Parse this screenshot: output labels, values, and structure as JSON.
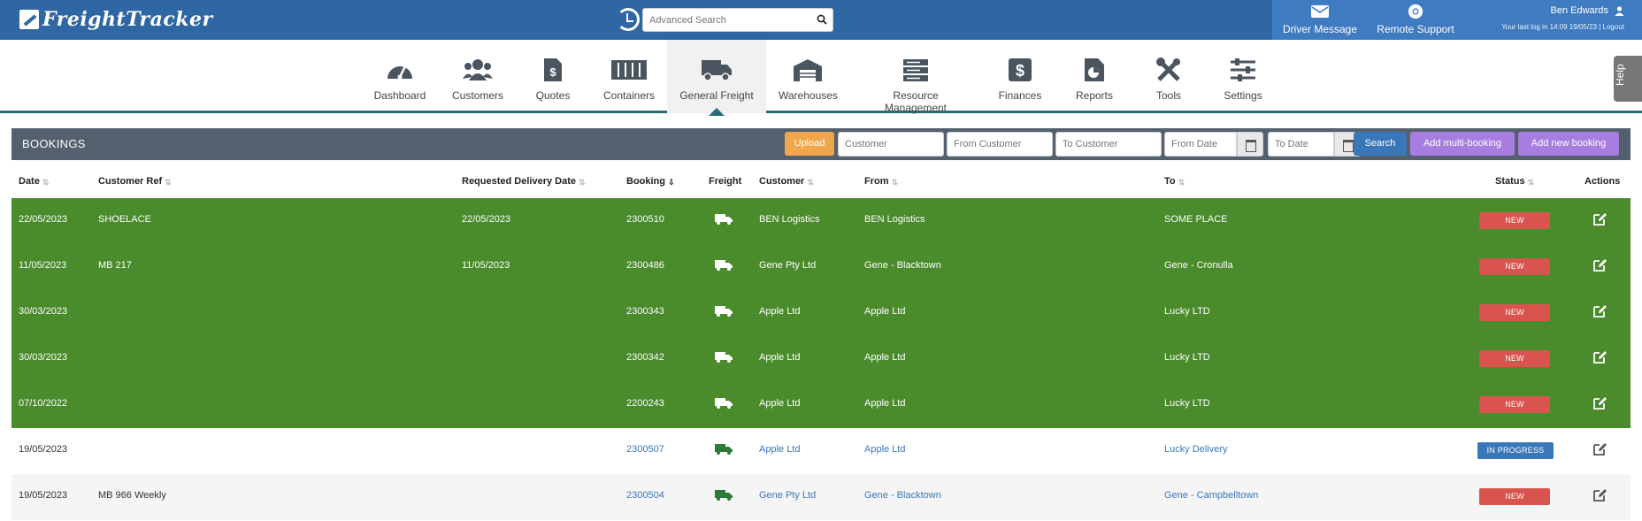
{
  "app": {
    "name": "FreightTracker"
  },
  "top": {
    "search_placeholder": "Advanced Search",
    "driver_message": "Driver Message",
    "remote_support": "Remote Support",
    "user_name": "Ben Edwards",
    "last_login": "Your last log in 14:09 19/05/23",
    "logout": "Logout"
  },
  "nav": {
    "items": [
      {
        "label": "Dashboard",
        "icon": "dashboard-icon"
      },
      {
        "label": "Customers",
        "icon": "users-icon"
      },
      {
        "label": "Quotes",
        "icon": "quote-icon"
      },
      {
        "label": "Containers",
        "icon": "container-icon"
      },
      {
        "label": "General Freight",
        "icon": "truck-icon",
        "active": true
      },
      {
        "label": "Warehouses",
        "icon": "warehouse-icon"
      },
      {
        "label": "Resource Management",
        "icon": "server-icon"
      },
      {
        "label": "Finances",
        "icon": "dollar-icon"
      },
      {
        "label": "Reports",
        "icon": "report-icon"
      },
      {
        "label": "Tools",
        "icon": "tools-icon"
      },
      {
        "label": "Settings",
        "icon": "sliders-icon"
      }
    ],
    "help": "Help"
  },
  "panel": {
    "title": "BOOKINGS",
    "upload": "Upload",
    "customer_placeholder": "Customer",
    "from_customer_placeholder": "From Customer",
    "to_customer_placeholder": "To Customer",
    "from_date_placeholder": "From Date",
    "to_date_placeholder": "To Date",
    "search": "Search",
    "add_multi": "Add multi-booking",
    "add_new": "Add new booking"
  },
  "columns": {
    "date": "Date",
    "customer_ref": "Customer Ref",
    "requested_delivery": "Requested Delivery Date",
    "booking": "Booking",
    "freight": "Freight",
    "customer": "Customer",
    "from": "From",
    "to": "To",
    "status": "Status",
    "actions": "Actions"
  },
  "rows": [
    {
      "date": "22/05/2023",
      "ref": "SHOELACE",
      "req": "22/05/2023",
      "booking": "2300510",
      "customer": "BEN Logistics",
      "from": "BEN Logistics",
      "to": "SOME PLACE",
      "status": "NEW",
      "style": "green"
    },
    {
      "date": "11/05/2023",
      "ref": "MB 217",
      "req": "11/05/2023",
      "booking": "2300486",
      "customer": "Gene Pty Ltd",
      "from": "Gene - Blacktown",
      "to": "Gene - Cronulla",
      "status": "NEW",
      "style": "green"
    },
    {
      "date": "30/03/2023",
      "ref": "",
      "req": "",
      "booking": "2300343",
      "customer": "Apple Ltd",
      "from": "Apple Ltd",
      "to": "Lucky LTD",
      "status": "NEW",
      "style": "green"
    },
    {
      "date": "30/03/2023",
      "ref": "",
      "req": "",
      "booking": "2300342",
      "customer": "Apple Ltd",
      "from": "Apple Ltd",
      "to": "Lucky LTD",
      "status": "NEW",
      "style": "green"
    },
    {
      "date": "07/10/2022",
      "ref": "",
      "req": "",
      "booking": "2200243",
      "customer": "Apple Ltd",
      "from": "Apple Ltd",
      "to": "Lucky LTD",
      "status": "NEW",
      "style": "green"
    },
    {
      "date": "19/05/2023",
      "ref": "",
      "req": "",
      "booking": "2300507",
      "customer": "Apple Ltd",
      "from": "Apple Ltd",
      "to": "Lucky Delivery",
      "status": "IN PROGRESS",
      "style": "white"
    },
    {
      "date": "19/05/2023",
      "ref": "MB 966 Weekly",
      "req": "",
      "booking": "2300504",
      "customer": "Gene Pty Ltd",
      "from": "Gene - Blacktown",
      "to": "Gene - Campbelltown",
      "status": "NEW",
      "style": "grey"
    }
  ]
}
